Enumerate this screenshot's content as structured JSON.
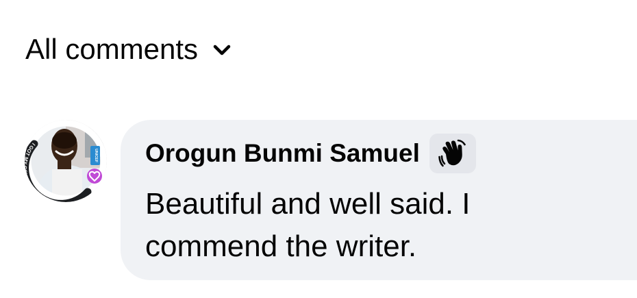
{
  "comments_filter": {
    "label": "All comments",
    "icon": "chevron-down-icon"
  },
  "comment": {
    "author": "Orogun Bunmi Samuel",
    "badge_icon": "waving-hand-icon",
    "text_line1": "Beautiful and well said. I",
    "text_line2": "commend the writer.",
    "avatar": {
      "frame_text": "I GOT MY COVID-19 VACCINE",
      "frame_tag": "UNICEF",
      "frame_icon": "heart-icon"
    }
  },
  "colors": {
    "text": "#050505",
    "bubble": "#f0f2f5",
    "badge_bg": "#e4e6eb",
    "frame_accent": "#c04ad6"
  }
}
